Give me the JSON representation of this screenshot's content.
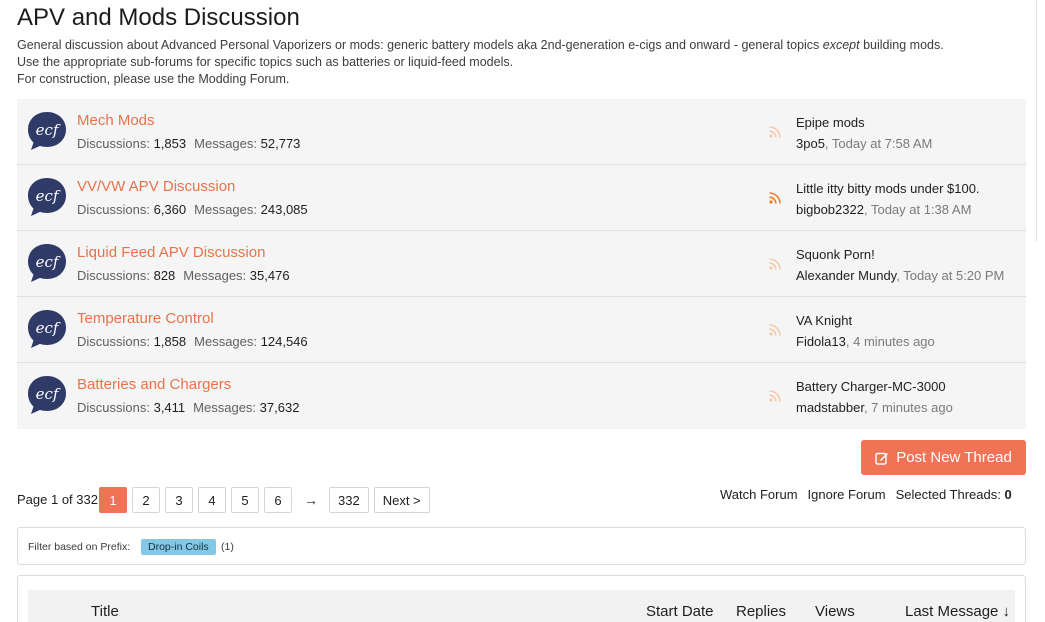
{
  "header": {
    "title": "APV and Mods Discussion",
    "description_line1_prefix": "General discussion about Advanced Personal Vaporizers or mods: generic battery models aka 2nd-generation e-cigs and onward - general topics ",
    "description_line1_emphasis": "except",
    "description_line1_suffix": " building mods.",
    "description_line2": "Use the appropriate sub-forums for specific topics such as batteries or liquid-feed models.",
    "description_line3": "For construction, please use the Modding Forum."
  },
  "labels": {
    "discussions": "Discussions:",
    "messages": "Messages:"
  },
  "forums": [
    {
      "title": "Mech Mods",
      "discussions": "1,853",
      "messages": "52,773",
      "last_thread": "Epipe mods",
      "last_author": "3po5",
      "last_time": ", Today at 7:58 AM",
      "rss_active": false
    },
    {
      "title": "VV/VW APV Discussion",
      "discussions": "6,360",
      "messages": "243,085",
      "last_thread": "Little itty bitty mods under $100.",
      "last_author": "bigbob2322",
      "last_time": ", Today at 1:38 AM",
      "rss_active": true
    },
    {
      "title": "Liquid Feed APV Discussion",
      "discussions": "828",
      "messages": "35,476",
      "last_thread": "Squonk Porn!",
      "last_author": "Alexander Mundy",
      "last_time": ", Today at 5:20 PM",
      "rss_active": false
    },
    {
      "title": "Temperature Control",
      "discussions": "1,858",
      "messages": "124,546",
      "last_thread": "VA Knight",
      "last_author": "Fidola13",
      "last_time": ", 4 minutes ago",
      "rss_active": false
    },
    {
      "title": "Batteries and Chargers",
      "discussions": "3,411",
      "messages": "37,632",
      "last_thread": "Battery Charger-MC-3000",
      "last_author": "madstabber",
      "last_time": ", 7 minutes ago",
      "rss_active": false
    }
  ],
  "post_button": {
    "label": "Post New Thread",
    "icon": "edit-icon"
  },
  "pagination": {
    "label": "Page 1 of 332",
    "pages": [
      "1",
      "2",
      "3",
      "4",
      "5",
      "6"
    ],
    "arrow": "→",
    "last_page": "332",
    "next": "Next >"
  },
  "forum_tools": {
    "watch": "Watch Forum",
    "ignore": "Ignore Forum",
    "selected_label": "Selected Threads:",
    "selected_count": "0"
  },
  "filter": {
    "label": "Filter based on Prefix:",
    "prefix": "Drop-in Coils",
    "count": "(1)"
  },
  "thread_columns": {
    "title": "Title",
    "start_date": "Start Date",
    "replies": "Replies",
    "views": "Views",
    "last_message": "Last Message ↓"
  },
  "colors": {
    "accent": "#f07356",
    "link": "#e8734a",
    "icon_bg": "#2f3a67",
    "rss_active": "#f07d2a",
    "rss_inactive": "#f4c8a8",
    "prefix_tag": "#85c8e6"
  }
}
